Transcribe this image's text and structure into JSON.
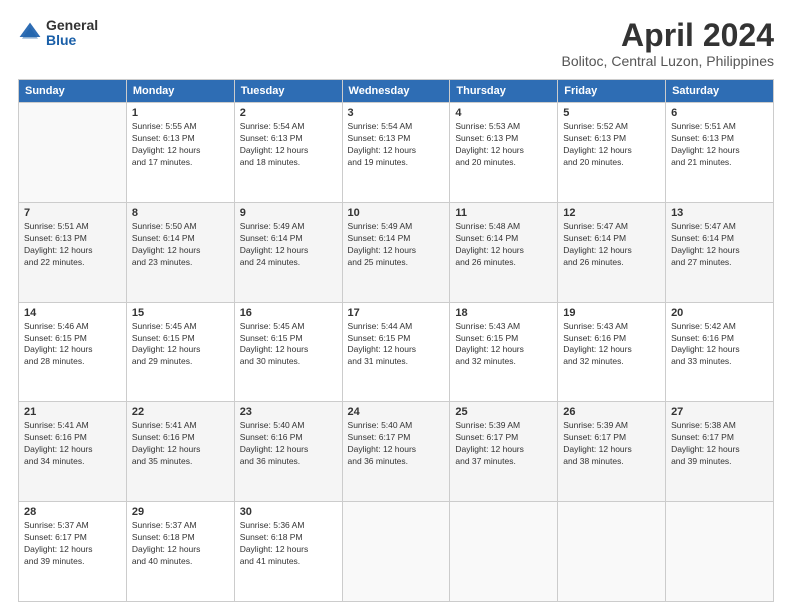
{
  "logo": {
    "general": "General",
    "blue": "Blue"
  },
  "title": "April 2024",
  "subtitle": "Bolitoc, Central Luzon, Philippines",
  "days_header": [
    "Sunday",
    "Monday",
    "Tuesday",
    "Wednesday",
    "Thursday",
    "Friday",
    "Saturday"
  ],
  "weeks": [
    [
      {
        "day": "",
        "info": ""
      },
      {
        "day": "1",
        "info": "Sunrise: 5:55 AM\nSunset: 6:13 PM\nDaylight: 12 hours\nand 17 minutes."
      },
      {
        "day": "2",
        "info": "Sunrise: 5:54 AM\nSunset: 6:13 PM\nDaylight: 12 hours\nand 18 minutes."
      },
      {
        "day": "3",
        "info": "Sunrise: 5:54 AM\nSunset: 6:13 PM\nDaylight: 12 hours\nand 19 minutes."
      },
      {
        "day": "4",
        "info": "Sunrise: 5:53 AM\nSunset: 6:13 PM\nDaylight: 12 hours\nand 20 minutes."
      },
      {
        "day": "5",
        "info": "Sunrise: 5:52 AM\nSunset: 6:13 PM\nDaylight: 12 hours\nand 20 minutes."
      },
      {
        "day": "6",
        "info": "Sunrise: 5:51 AM\nSunset: 6:13 PM\nDaylight: 12 hours\nand 21 minutes."
      }
    ],
    [
      {
        "day": "7",
        "info": "Sunrise: 5:51 AM\nSunset: 6:13 PM\nDaylight: 12 hours\nand 22 minutes."
      },
      {
        "day": "8",
        "info": "Sunrise: 5:50 AM\nSunset: 6:14 PM\nDaylight: 12 hours\nand 23 minutes."
      },
      {
        "day": "9",
        "info": "Sunrise: 5:49 AM\nSunset: 6:14 PM\nDaylight: 12 hours\nand 24 minutes."
      },
      {
        "day": "10",
        "info": "Sunrise: 5:49 AM\nSunset: 6:14 PM\nDaylight: 12 hours\nand 25 minutes."
      },
      {
        "day": "11",
        "info": "Sunrise: 5:48 AM\nSunset: 6:14 PM\nDaylight: 12 hours\nand 26 minutes."
      },
      {
        "day": "12",
        "info": "Sunrise: 5:47 AM\nSunset: 6:14 PM\nDaylight: 12 hours\nand 26 minutes."
      },
      {
        "day": "13",
        "info": "Sunrise: 5:47 AM\nSunset: 6:14 PM\nDaylight: 12 hours\nand 27 minutes."
      }
    ],
    [
      {
        "day": "14",
        "info": "Sunrise: 5:46 AM\nSunset: 6:15 PM\nDaylight: 12 hours\nand 28 minutes."
      },
      {
        "day": "15",
        "info": "Sunrise: 5:45 AM\nSunset: 6:15 PM\nDaylight: 12 hours\nand 29 minutes."
      },
      {
        "day": "16",
        "info": "Sunrise: 5:45 AM\nSunset: 6:15 PM\nDaylight: 12 hours\nand 30 minutes."
      },
      {
        "day": "17",
        "info": "Sunrise: 5:44 AM\nSunset: 6:15 PM\nDaylight: 12 hours\nand 31 minutes."
      },
      {
        "day": "18",
        "info": "Sunrise: 5:43 AM\nSunset: 6:15 PM\nDaylight: 12 hours\nand 32 minutes."
      },
      {
        "day": "19",
        "info": "Sunrise: 5:43 AM\nSunset: 6:16 PM\nDaylight: 12 hours\nand 32 minutes."
      },
      {
        "day": "20",
        "info": "Sunrise: 5:42 AM\nSunset: 6:16 PM\nDaylight: 12 hours\nand 33 minutes."
      }
    ],
    [
      {
        "day": "21",
        "info": "Sunrise: 5:41 AM\nSunset: 6:16 PM\nDaylight: 12 hours\nand 34 minutes."
      },
      {
        "day": "22",
        "info": "Sunrise: 5:41 AM\nSunset: 6:16 PM\nDaylight: 12 hours\nand 35 minutes."
      },
      {
        "day": "23",
        "info": "Sunrise: 5:40 AM\nSunset: 6:16 PM\nDaylight: 12 hours\nand 36 minutes."
      },
      {
        "day": "24",
        "info": "Sunrise: 5:40 AM\nSunset: 6:17 PM\nDaylight: 12 hours\nand 36 minutes."
      },
      {
        "day": "25",
        "info": "Sunrise: 5:39 AM\nSunset: 6:17 PM\nDaylight: 12 hours\nand 37 minutes."
      },
      {
        "day": "26",
        "info": "Sunrise: 5:39 AM\nSunset: 6:17 PM\nDaylight: 12 hours\nand 38 minutes."
      },
      {
        "day": "27",
        "info": "Sunrise: 5:38 AM\nSunset: 6:17 PM\nDaylight: 12 hours\nand 39 minutes."
      }
    ],
    [
      {
        "day": "28",
        "info": "Sunrise: 5:37 AM\nSunset: 6:17 PM\nDaylight: 12 hours\nand 39 minutes."
      },
      {
        "day": "29",
        "info": "Sunrise: 5:37 AM\nSunset: 6:18 PM\nDaylight: 12 hours\nand 40 minutes."
      },
      {
        "day": "30",
        "info": "Sunrise: 5:36 AM\nSunset: 6:18 PM\nDaylight: 12 hours\nand 41 minutes."
      },
      {
        "day": "",
        "info": ""
      },
      {
        "day": "",
        "info": ""
      },
      {
        "day": "",
        "info": ""
      },
      {
        "day": "",
        "info": ""
      }
    ]
  ]
}
